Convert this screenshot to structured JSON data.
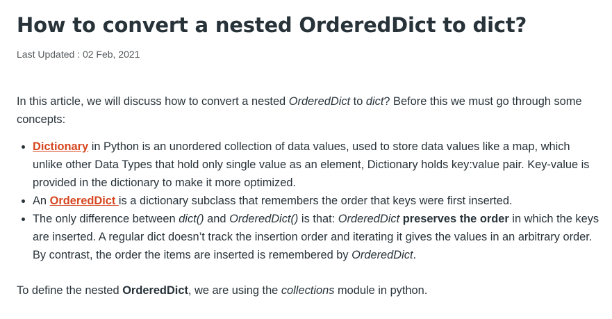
{
  "article": {
    "title": "How to convert a nested OrderedDict to dict?",
    "last_updated": "Last Updated : 02 Feb, 2021",
    "intro": {
      "t1": "In this article, we will discuss how to convert a nested ",
      "em1": "OrderedDict",
      "t2": " to ",
      "em2": "dict",
      "t3": "? Before this we must go through some concepts:"
    },
    "bullets": {
      "b1": {
        "link": "Dictionary",
        "text": " in Python is an unordered collection of data values, used to store data values like a map, which unlike other Data Types that hold only single value as an element, Dictionary holds key:value pair. Key-value is provided in the dictionary to make it more optimized."
      },
      "b2": {
        "pre": "An ",
        "link": "OrderedDict ",
        "text": "is a dictionary subclass that remembers the order that keys were first inserted."
      },
      "b3": {
        "t1": "The only difference between ",
        "em1": "dict()",
        "t2": " and ",
        "em2": "OrderedDict()",
        "t3": " is that: ",
        "em3": "OrderedDict",
        "strong": " preserves the order",
        "t4": " in which the keys are inserted. A regular dict doesn’t track the insertion order and iterating it gives the values in an arbitrary order. By contrast, the order the items are inserted is remembered by ",
        "em4": "OrderedDict",
        "t5": "."
      }
    },
    "outro": {
      "t1": "To define the nested ",
      "strong": "OrderedDict",
      "t2": ", we are using the ",
      "em": "collections",
      "t3": " module in python."
    }
  }
}
